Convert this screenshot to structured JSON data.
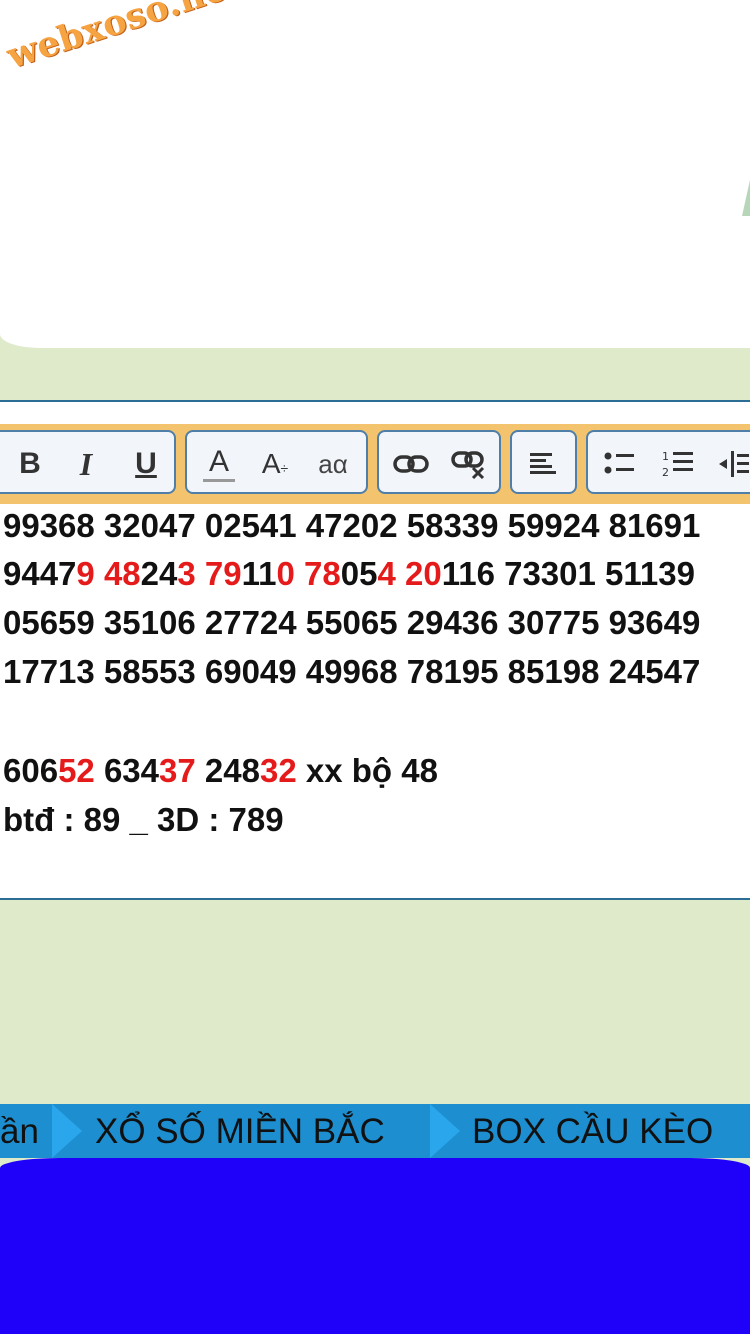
{
  "watermark": "webxoso.net",
  "toolbar": {
    "buttons": [
      {
        "name": "bold-button",
        "icon": "bold-icon"
      },
      {
        "name": "italic-button",
        "icon": "italic-icon"
      },
      {
        "name": "underline-button",
        "icon": "underline-icon"
      },
      {
        "name": "font-color-button",
        "icon": "font-color-icon"
      },
      {
        "name": "font-size-button",
        "icon": "font-size-icon"
      },
      {
        "name": "font-family-button",
        "icon": "font-family-icon"
      },
      {
        "name": "link-button",
        "icon": "link-icon"
      },
      {
        "name": "unlink-button",
        "icon": "unlink-icon"
      },
      {
        "name": "align-left-button",
        "icon": "align-left-icon"
      },
      {
        "name": "bullet-list-button",
        "icon": "bullet-list-icon"
      },
      {
        "name": "numbered-list-button",
        "icon": "numbered-list-icon"
      },
      {
        "name": "indent-button",
        "icon": "indent-icon"
      }
    ],
    "bold_label": "B",
    "italic_label": "I",
    "underline_label": "U",
    "font_color_label": "A",
    "font_size_label": "A",
    "font_family_label": "aα"
  },
  "editor": {
    "row1": "99368 32047 02541 47202 58339 59924 81691",
    "row2": [
      {
        "t": "9447",
        "c": "black"
      },
      {
        "t": "9 48",
        "c": "red"
      },
      {
        "t": "24",
        "c": "black"
      },
      {
        "t": "3 79",
        "c": "red"
      },
      {
        "t": "11",
        "c": "black"
      },
      {
        "t": "0 78",
        "c": "red"
      },
      {
        "t": "05",
        "c": "black"
      },
      {
        "t": "4 20",
        "c": "red"
      },
      {
        "t": "116 73301 51139",
        "c": "black"
      }
    ],
    "row3": "05659 35106 27724 55065 29436 30775 93649",
    "row4": "17713 58553 69049 49968 78195 85198 24547",
    "row5": [
      {
        "t": "606",
        "c": "black"
      },
      {
        "t": "52",
        "c": "red"
      },
      {
        "t": " 634",
        "c": "black"
      },
      {
        "t": "37",
        "c": "red"
      },
      {
        "t": " 248",
        "c": "black"
      },
      {
        "t": "32",
        "c": "red"
      },
      {
        "t": " xx bộ 48",
        "c": "black"
      }
    ],
    "row6": "btđ : 89 _ 3D : 789"
  },
  "nav": {
    "items": [
      "ần",
      "XỔ SỐ MIỀN BẮC",
      "BOX CẦU KÈO"
    ]
  },
  "colors": {
    "background": "#dfeacb",
    "toolbar": "#f3c46d",
    "highlight_red": "#e51b1b",
    "nav_bar": "#1d8fd0",
    "blue_block": "#1f00f8"
  }
}
